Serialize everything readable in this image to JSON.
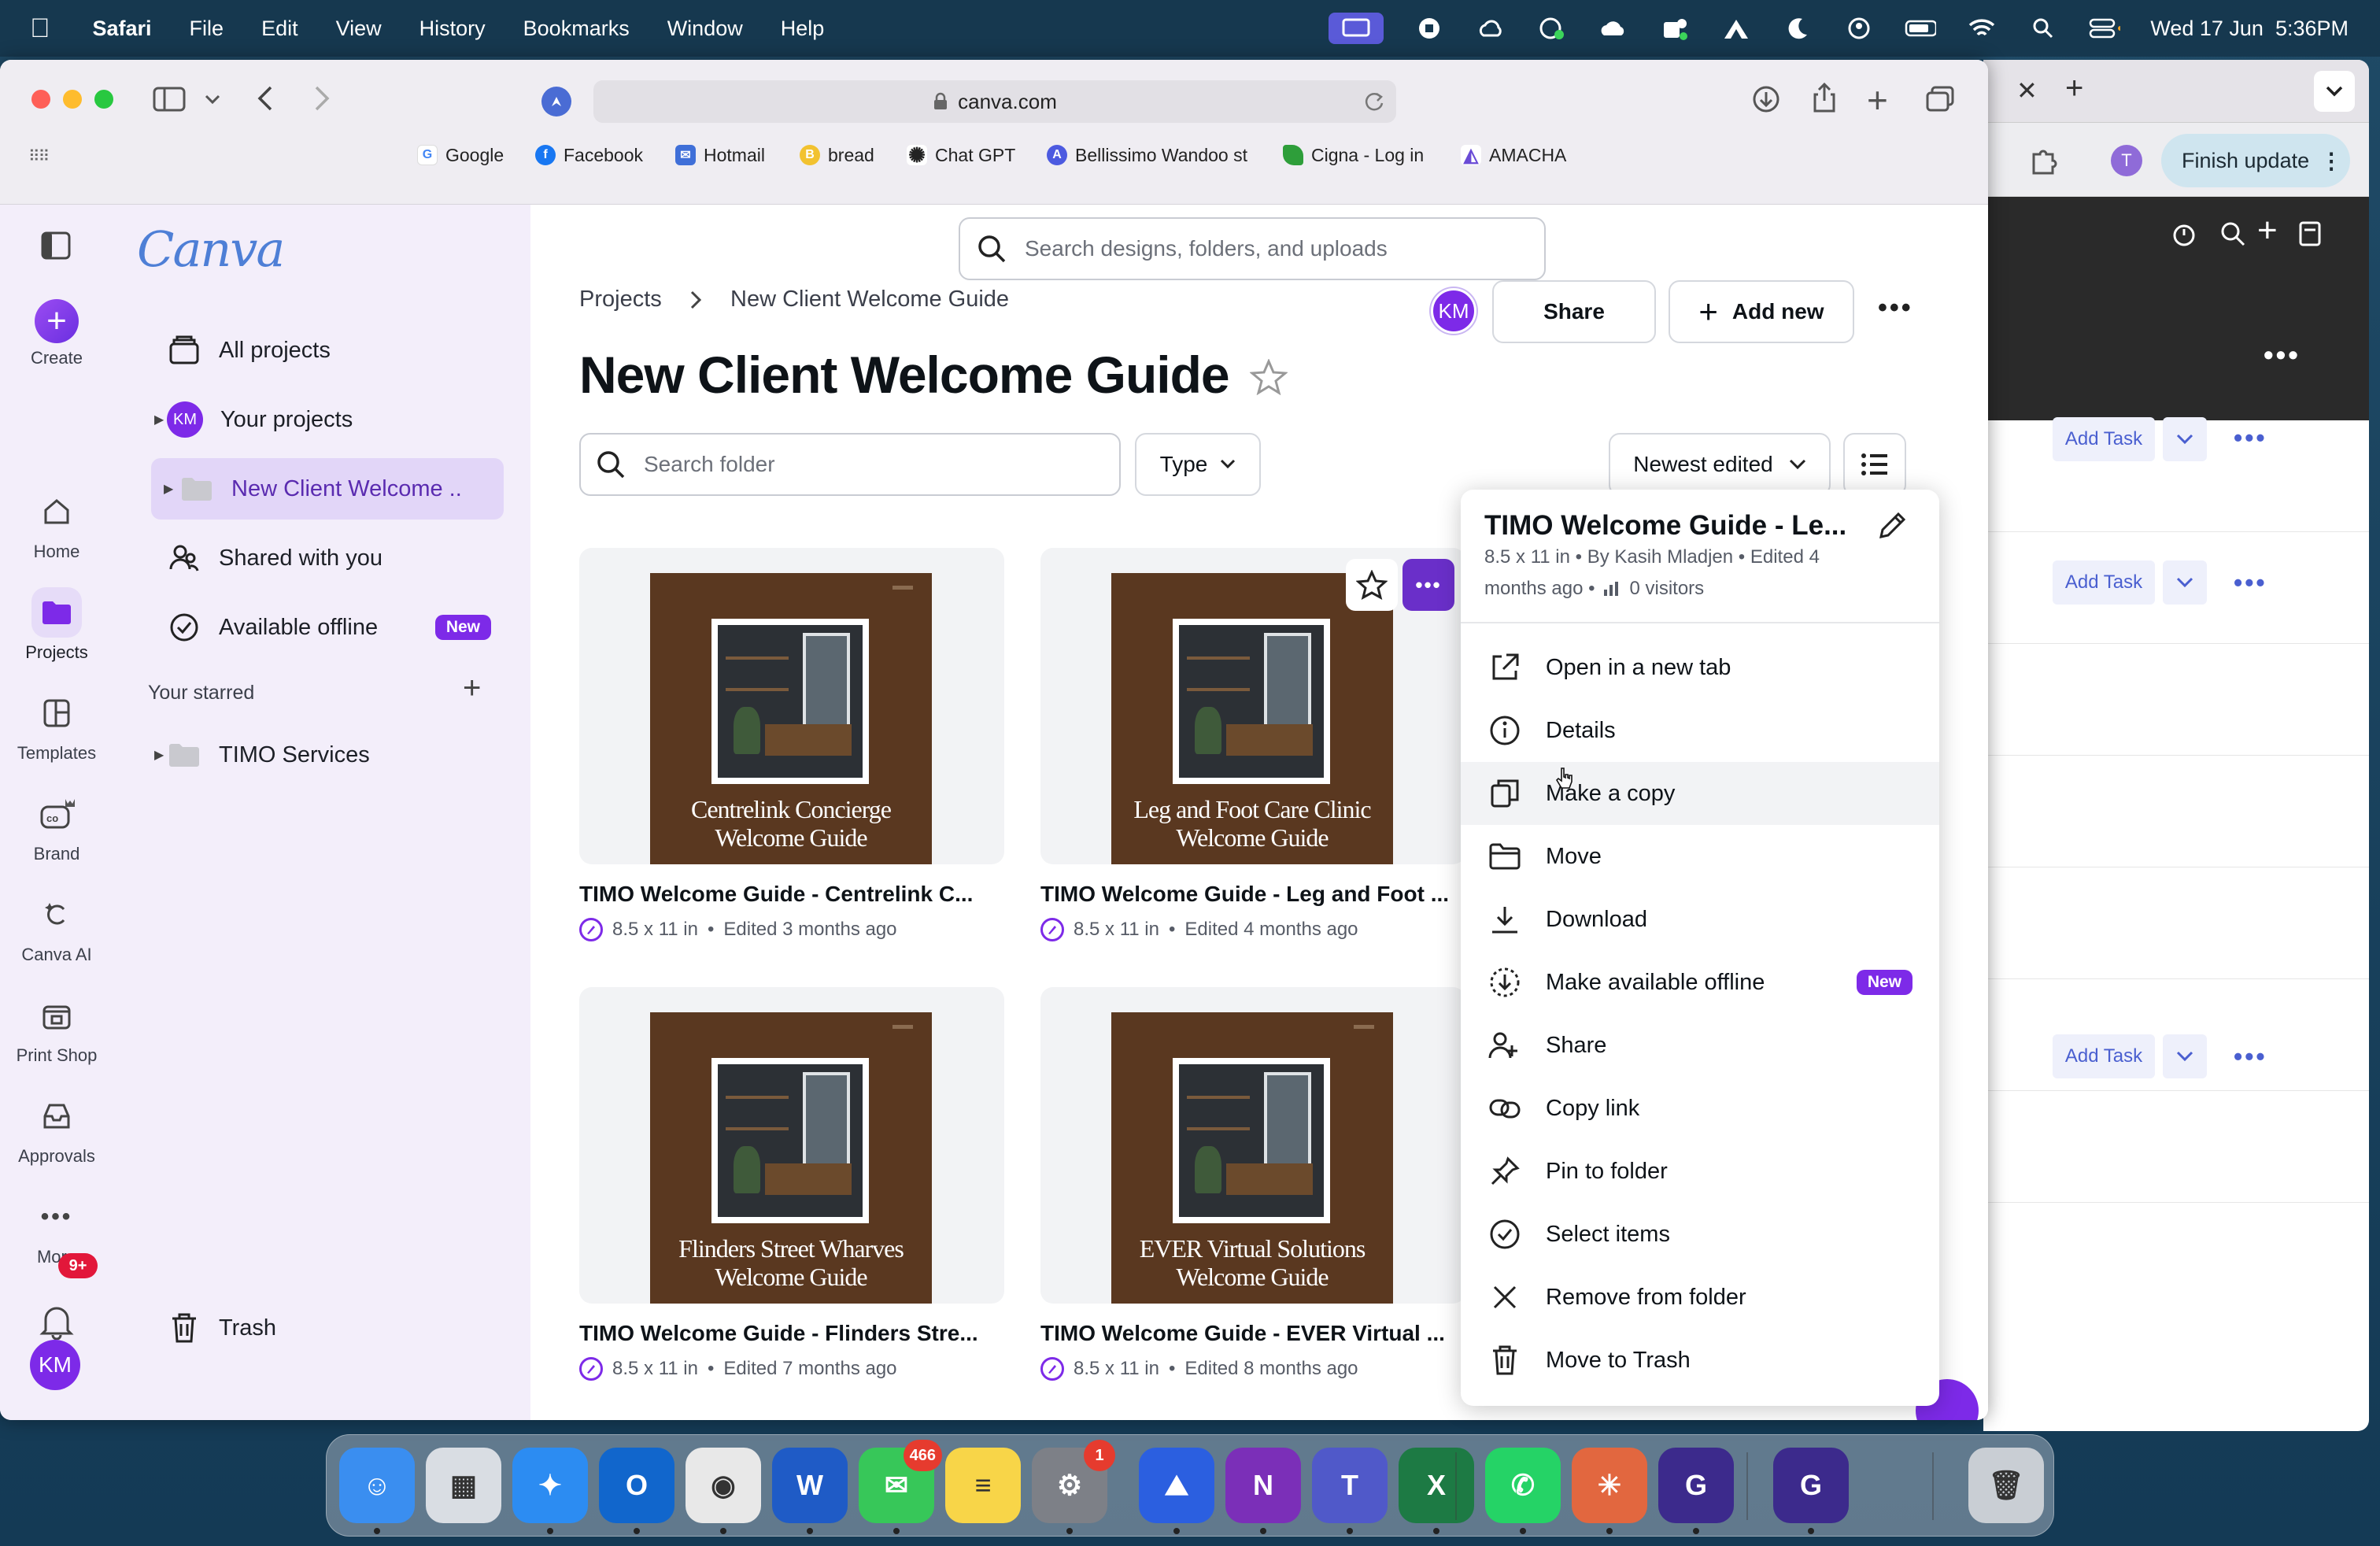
{
  "menubar": {
    "app": "Safari",
    "items": [
      "File",
      "Edit",
      "View",
      "History",
      "Bookmarks",
      "Window",
      "Help"
    ],
    "datetime": "Wed 17 Jun  5:36PM"
  },
  "safari": {
    "url": "canva.com",
    "bookmarks": [
      {
        "label": "Google",
        "color": "#4285f4",
        "glyph": "G"
      },
      {
        "label": "Facebook",
        "color": "#1877f2",
        "glyph": "f"
      },
      {
        "label": "Hotmail",
        "color": "#3f6fd8",
        "glyph": "✉"
      },
      {
        "label": "bread",
        "color": "#f2c230",
        "glyph": "B"
      },
      {
        "label": "Chat GPT",
        "color": "#222222",
        "glyph": "✺"
      },
      {
        "label": "Bellissimo Wandoo st",
        "color": "#4c5ae0",
        "glyph": "A"
      },
      {
        "label": "Cigna - Log in",
        "color": "#2e9e3a",
        "glyph": "❧"
      },
      {
        "label": "AMACHA",
        "color": "#6a4bd6",
        "glyph": "◭"
      }
    ]
  },
  "right_window": {
    "profile_initial": "T",
    "finish_update": "Finish update",
    "add_task": "Add Task"
  },
  "rail": {
    "create": "Create",
    "items": [
      "Home",
      "Projects",
      "Templates",
      "Brand",
      "Canva AI",
      "Print Shop",
      "Approvals",
      "More"
    ],
    "notification_count": "9+",
    "avatar": "KM"
  },
  "sidebar": {
    "logo": "Canva",
    "all_projects": "All projects",
    "your_projects": "Your projects",
    "your_projects_avatar": "KM",
    "current_folder": "New Client Welcome ..",
    "shared": "Shared with you",
    "offline": "Available offline",
    "new_badge": "New",
    "starred_heading": "Your starred",
    "starred_item": "TIMO Services",
    "trash": "Trash"
  },
  "main": {
    "search_placeholder": "Search designs, folders, and uploads",
    "breadcrumb_root": "Projects",
    "breadcrumb_current": "New Client Welcome Guide",
    "avatar": "KM",
    "share": "Share",
    "add_new": "Add new",
    "title": "New Client Welcome Guide",
    "folder_search_placeholder": "Search folder",
    "type_filter": "Type",
    "sort": "Newest edited"
  },
  "cards": [
    {
      "poster": "Centrelink Concierge Welcome Guide",
      "name": "TIMO Welcome Guide - Centrelink C...",
      "size": "8.5 x 11 in",
      "edited": "Edited 3 months ago"
    },
    {
      "poster": "Leg and Foot Care Clinic Welcome Guide",
      "name": "TIMO Welcome Guide - Leg and Foot ...",
      "size": "8.5 x 11 in",
      "edited": "Edited 4 months ago"
    },
    {
      "poster": "Flinders Street Wharves Welcome Guide",
      "name": "TIMO Welcome Guide - Flinders Stre...",
      "size": "8.5 x 11 in",
      "edited": "Edited 7 months ago"
    },
    {
      "poster": "EVER Virtual Solutions Welcome Guide",
      "name": "TIMO Welcome Guide - EVER Virtual ...",
      "size": "8.5 x 11 in",
      "edited": "Edited 8 months ago"
    }
  ],
  "context_menu": {
    "title": "TIMO Welcome Guide - Le...",
    "meta_line1": "8.5 x 11 in • By Kasih Mladjen • Edited 4",
    "meta_line2": "months ago •",
    "visitors": "0 visitors",
    "items": [
      {
        "label": "Open in a new tab",
        "icon": "external-link-icon"
      },
      {
        "label": "Details",
        "icon": "info-icon"
      },
      {
        "label": "Make a copy",
        "icon": "copy-icon"
      },
      {
        "label": "Move",
        "icon": "folder-icon"
      },
      {
        "label": "Download",
        "icon": "download-icon"
      },
      {
        "label": "Make available offline",
        "icon": "offline-icon",
        "badge": "New"
      },
      {
        "label": "Share",
        "icon": "share-people-icon"
      },
      {
        "label": "Copy link",
        "icon": "link-icon"
      },
      {
        "label": "Pin to folder",
        "icon": "pin-icon"
      },
      {
        "label": "Select items",
        "icon": "check-circle-icon"
      },
      {
        "label": "Remove from folder",
        "icon": "x-icon"
      },
      {
        "label": "Move to Trash",
        "icon": "trash-icon"
      }
    ],
    "hovered_index": 2
  },
  "dock": {
    "apps": [
      {
        "name": "Finder",
        "color": "#3a8ef0",
        "glyph": "☺"
      },
      {
        "name": "Launchpad",
        "color": "#d9dde3",
        "glyph": "▦"
      },
      {
        "name": "Safari",
        "color": "#2c8cf2",
        "glyph": "✦"
      },
      {
        "name": "Outlook",
        "color": "#1166cc",
        "glyph": "O"
      },
      {
        "name": "Chrome",
        "color": "#e8e8e8",
        "glyph": "◉"
      },
      {
        "name": "Word",
        "color": "#1f5bc6",
        "glyph": "W"
      },
      {
        "name": "Messages",
        "color": "#37c759",
        "glyph": "✉",
        "badge": "466"
      },
      {
        "name": "Notes",
        "color": "#f8d548",
        "glyph": "≡"
      },
      {
        "name": "System Settings",
        "color": "#7d8087",
        "glyph": "⚙",
        "badge": "1"
      },
      {
        "name": "Mountain Duck",
        "color": "#2b5fe0",
        "glyph": "⛰"
      },
      {
        "name": "OneNote",
        "color": "#7b2fb8",
        "glyph": "N"
      },
      {
        "name": "Teams",
        "color": "#5059c9",
        "glyph": "T"
      },
      {
        "name": "Excel",
        "color": "#1d7a44",
        "glyph": "X"
      },
      {
        "name": "WhatsApp",
        "color": "#25d366",
        "glyph": "✆"
      },
      {
        "name": "Claude",
        "color": "#e2673f",
        "glyph": "✳"
      },
      {
        "name": "Grammarly",
        "color": "#3c2a8c",
        "glyph": "G"
      },
      {
        "name": "Grammarly Docs",
        "color": "#3c2a8c",
        "glyph": "G"
      },
      {
        "name": "Trash",
        "color": "#c9ced4",
        "glyph": "🗑"
      }
    ]
  }
}
